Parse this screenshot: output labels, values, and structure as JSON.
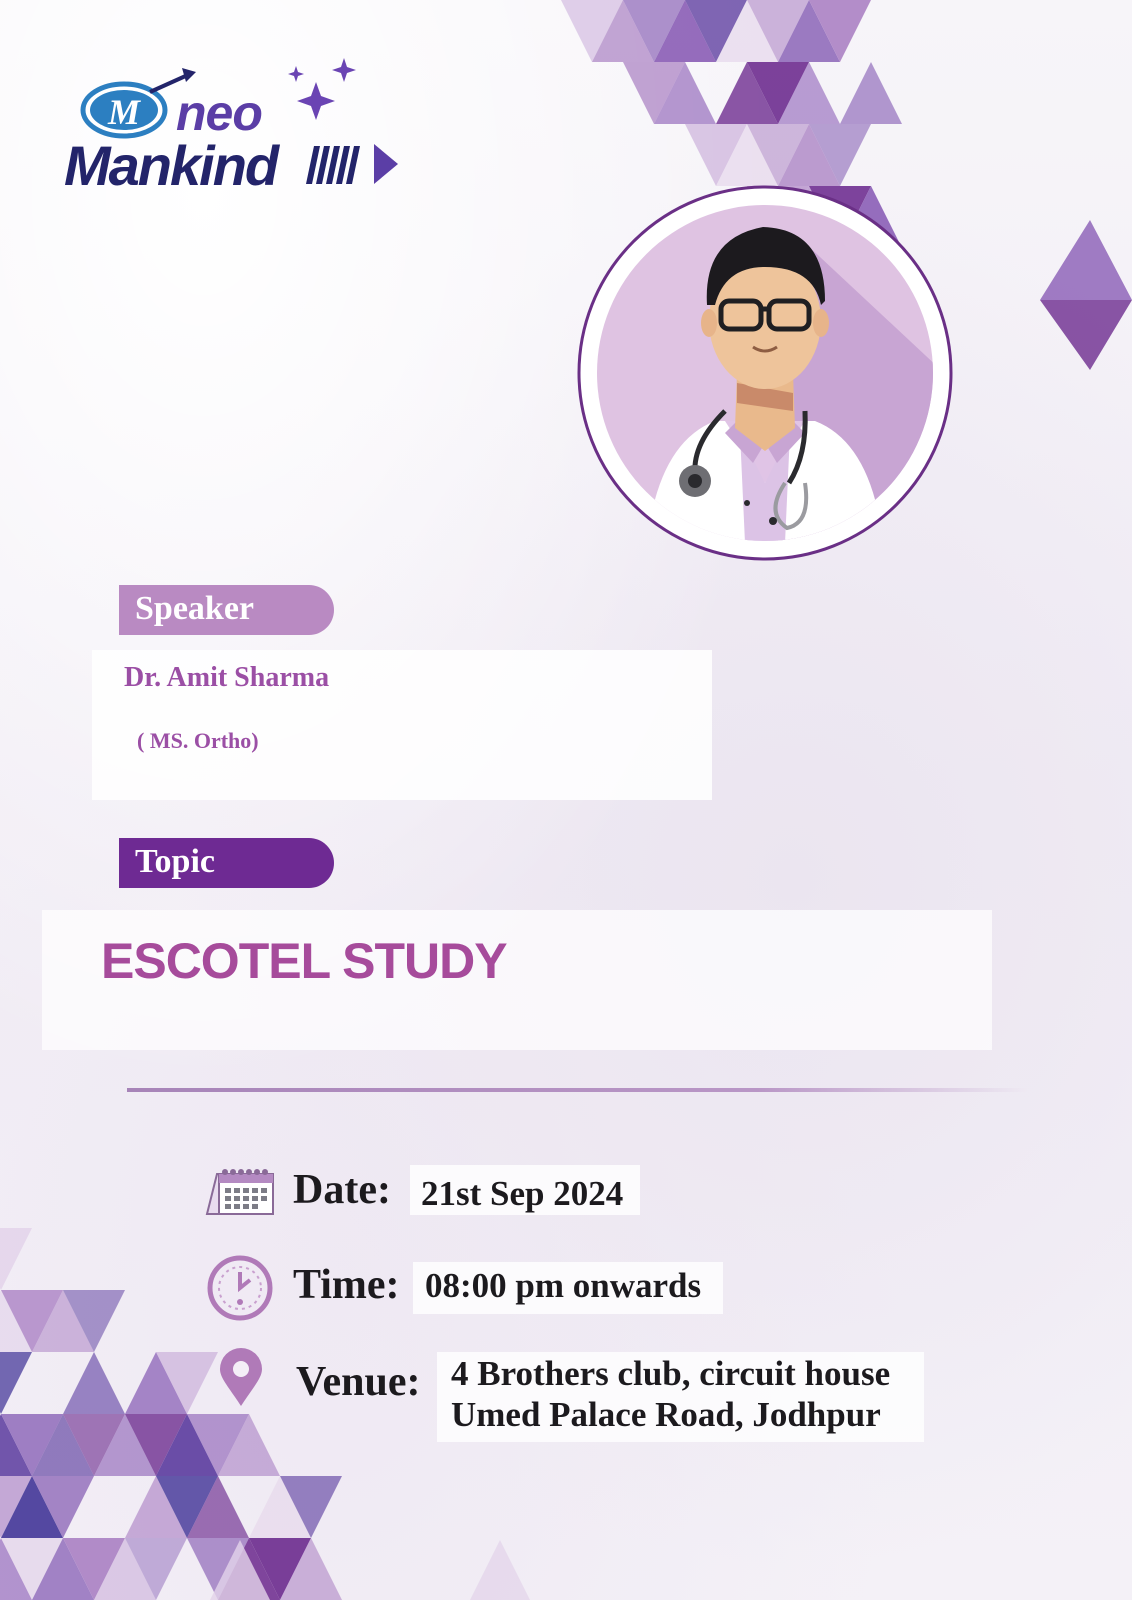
{
  "brand": {
    "logo_mark": "M",
    "logo_top": "neo",
    "logo_bottom": "Mankind",
    "colors": {
      "accent_purple": "#6e2a93",
      "light_purple": "#b98ac2",
      "text_purple": "#9b4fa5",
      "navy": "#23246a"
    }
  },
  "speaker": {
    "label": "Speaker",
    "name": "Dr. Amit Sharma",
    "qualification": "( MS. Ortho)"
  },
  "topic": {
    "label": "Topic",
    "title": "ESCOTEL STUDY"
  },
  "details": {
    "date_label": "Date:",
    "date_value": "21st Sep 2024",
    "time_label": "Time:",
    "time_value": "08:00 pm onwards",
    "venue_label": "Venue:",
    "venue_line1": "4 Brothers club, circuit house",
    "venue_line2": "Umed Palace Road, Jodhpur"
  },
  "icons": {
    "date": "calendar-icon",
    "time": "clock-icon",
    "venue": "location-pin-icon",
    "portrait": "doctor-avatar-icon"
  }
}
